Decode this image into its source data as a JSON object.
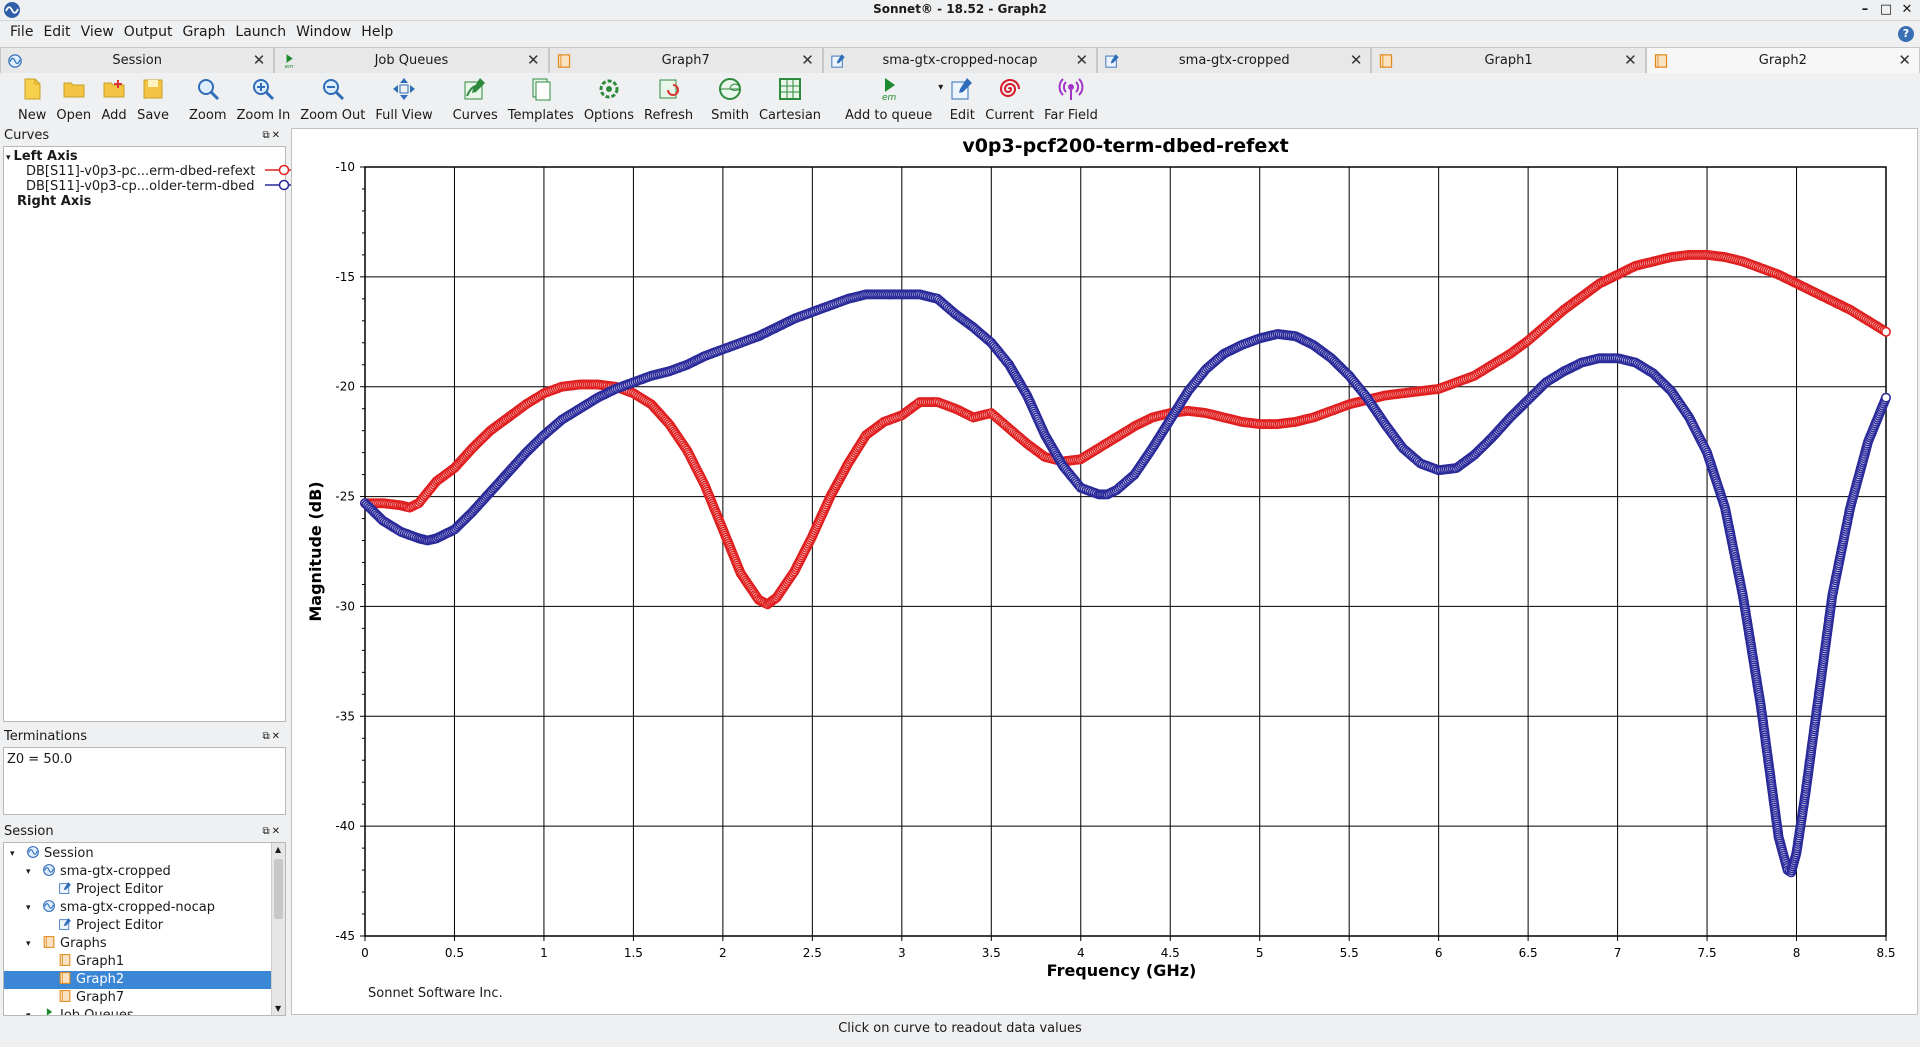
{
  "window": {
    "title": "Sonnet® - 18.52 - Graph2",
    "min_label": "–",
    "max_label": "□",
    "close_label": "✕"
  },
  "menu": [
    "File",
    "Edit",
    "View",
    "Output",
    "Graph",
    "Launch",
    "Window",
    "Help"
  ],
  "tabs": [
    {
      "label": "Session",
      "icon": "sonnet-session-icon",
      "active": false
    },
    {
      "label": "Job Queues",
      "icon": "em-queue-icon",
      "active": false
    },
    {
      "label": "Graph7",
      "icon": "graph-doc-icon",
      "active": false
    },
    {
      "label": "sma-gtx-cropped-nocap",
      "icon": "project-editor-icon",
      "active": false
    },
    {
      "label": "sma-gtx-cropped",
      "icon": "project-editor-icon",
      "active": false
    },
    {
      "label": "Graph1",
      "icon": "graph-doc-icon",
      "active": false
    },
    {
      "label": "Graph2",
      "icon": "graph-doc-icon",
      "active": true
    }
  ],
  "toolbar": [
    {
      "label": "New",
      "icon": "new-file-icon"
    },
    {
      "label": "Open",
      "icon": "open-folder-icon"
    },
    {
      "label": "Add",
      "icon": "add-folder-icon"
    },
    {
      "label": "Save",
      "icon": "save-icon"
    },
    {
      "label": "Zoom",
      "icon": "zoom-icon"
    },
    {
      "label": "Zoom In",
      "icon": "zoom-in-icon"
    },
    {
      "label": "Zoom Out",
      "icon": "zoom-out-icon"
    },
    {
      "label": "Full View",
      "icon": "full-view-icon"
    },
    {
      "label": "Curves",
      "icon": "curves-icon"
    },
    {
      "label": "Templates",
      "icon": "templates-icon"
    },
    {
      "label": "Options",
      "icon": "options-icon"
    },
    {
      "label": "Refresh",
      "icon": "refresh-icon"
    },
    {
      "label": "Smith",
      "icon": "smith-chart-icon"
    },
    {
      "label": "Cartesian",
      "icon": "cartesian-grid-icon"
    },
    {
      "label": "Add to queue",
      "icon": "em-run-icon"
    },
    {
      "label": "Edit",
      "icon": "edit-icon"
    },
    {
      "label": "Current",
      "icon": "current-spiral-icon"
    },
    {
      "label": "Far Field",
      "icon": "far-field-icon"
    }
  ],
  "curves_panel": {
    "title": "Curves",
    "left_axis": "Left Axis",
    "right_axis": "Right Axis",
    "curves": [
      {
        "label": "DB[S11]-v0p3-pc...erm-dbed-refext",
        "color": "#e02020"
      },
      {
        "label": "DB[S11]-v0p3-cp...older-term-dbed",
        "color": "#2a2a9a"
      }
    ]
  },
  "terminations_panel": {
    "title": "Terminations",
    "value": "Z0 = 50.0"
  },
  "session_panel": {
    "title": "Session",
    "tree": [
      {
        "label": "Session",
        "indent": 0,
        "twist": "▾",
        "icon": "sonnet-session-icon",
        "selected": false
      },
      {
        "label": "sma-gtx-cropped",
        "indent": 1,
        "twist": "▾",
        "icon": "sonnet-project-icon",
        "selected": false
      },
      {
        "label": "Project Editor",
        "indent": 2,
        "twist": "",
        "icon": "project-editor-icon",
        "selected": false
      },
      {
        "label": "sma-gtx-cropped-nocap",
        "indent": 1,
        "twist": "▾",
        "icon": "sonnet-project-icon",
        "selected": false
      },
      {
        "label": "Project Editor",
        "indent": 2,
        "twist": "",
        "icon": "project-editor-icon",
        "selected": false
      },
      {
        "label": "Graphs",
        "indent": 1,
        "twist": "▾",
        "icon": "graph-doc-icon",
        "selected": false
      },
      {
        "label": "Graph1",
        "indent": 2,
        "twist": "",
        "icon": "graph-doc-icon",
        "selected": false
      },
      {
        "label": "Graph2",
        "indent": 2,
        "twist": "",
        "icon": "graph-doc-icon",
        "selected": true
      },
      {
        "label": "Graph7",
        "indent": 2,
        "twist": "",
        "icon": "graph-doc-icon",
        "selected": false
      },
      {
        "label": "Job Queues",
        "indent": 1,
        "twist": "▾",
        "icon": "em-queue-icon",
        "selected": false
      }
    ]
  },
  "footer_text": "Sonnet Software Inc.",
  "status_text": "Click on curve to readout data values",
  "chart_data": {
    "type": "line",
    "title": "v0p3-pcf200-term-dbed-refext",
    "xlabel": "Frequency (GHz)",
    "ylabel": "Magnitude (dB)",
    "xlim": [
      0,
      8.5
    ],
    "ylim": [
      -45,
      -10
    ],
    "xticks": [
      0,
      0.5,
      1,
      1.5,
      2,
      2.5,
      3,
      3.5,
      4,
      4.5,
      5,
      5.5,
      6,
      6.5,
      7,
      7.5,
      8,
      8.5
    ],
    "xtick_labels": [
      "0",
      "0.5",
      "1",
      "1.5",
      "2",
      "2.5",
      "3",
      "3.5",
      "4",
      "4.5",
      "5",
      "5.5",
      "6",
      "6.5",
      "7",
      "7.5",
      "8",
      "8.5"
    ],
    "yticks": [
      -10,
      -15,
      -20,
      -25,
      -30,
      -35,
      -40,
      -45
    ],
    "ytick_labels": [
      "-10",
      "-15",
      "-20",
      "-25",
      "-30",
      "-35",
      "-40",
      "-45"
    ],
    "grid": true,
    "series": [
      {
        "name": "DB[S11]-v0p3-pc...erm-dbed-refext",
        "color": "#e02020",
        "x": [
          0,
          0.1,
          0.2,
          0.25,
          0.3,
          0.4,
          0.5,
          0.6,
          0.7,
          0.8,
          0.9,
          1.0,
          1.1,
          1.2,
          1.3,
          1.4,
          1.5,
          1.6,
          1.7,
          1.8,
          1.9,
          2.0,
          2.1,
          2.2,
          2.25,
          2.3,
          2.4,
          2.5,
          2.6,
          2.7,
          2.8,
          2.9,
          3.0,
          3.1,
          3.2,
          3.3,
          3.4,
          3.5,
          3.6,
          3.7,
          3.8,
          3.9,
          4.0,
          4.1,
          4.2,
          4.3,
          4.4,
          4.5,
          4.6,
          4.7,
          4.8,
          4.9,
          5.0,
          5.1,
          5.2,
          5.3,
          5.4,
          5.5,
          5.6,
          5.7,
          5.8,
          5.9,
          6.0,
          6.1,
          6.2,
          6.3,
          6.4,
          6.5,
          6.6,
          6.7,
          6.8,
          6.9,
          7.0,
          7.1,
          7.2,
          7.3,
          7.4,
          7.5,
          7.6,
          7.7,
          7.8,
          7.9,
          8.0,
          8.1,
          8.2,
          8.3,
          8.4,
          8.5
        ],
        "y": [
          -25.3,
          -25.3,
          -25.4,
          -25.5,
          -25.3,
          -24.3,
          -23.7,
          -22.8,
          -22.0,
          -21.4,
          -20.8,
          -20.3,
          -20.0,
          -19.9,
          -19.9,
          -20.0,
          -20.3,
          -20.8,
          -21.7,
          -22.9,
          -24.5,
          -26.5,
          -28.5,
          -29.7,
          -29.9,
          -29.6,
          -28.4,
          -26.8,
          -25.0,
          -23.5,
          -22.2,
          -21.6,
          -21.3,
          -20.7,
          -20.7,
          -21.0,
          -21.4,
          -21.2,
          -21.9,
          -22.6,
          -23.2,
          -23.4,
          -23.3,
          -22.8,
          -22.3,
          -21.8,
          -21.4,
          -21.2,
          -21.1,
          -21.2,
          -21.4,
          -21.6,
          -21.7,
          -21.7,
          -21.6,
          -21.4,
          -21.1,
          -20.8,
          -20.6,
          -20.4,
          -20.3,
          -20.2,
          -20.1,
          -19.8,
          -19.5,
          -19.0,
          -18.5,
          -17.9,
          -17.2,
          -16.5,
          -15.9,
          -15.3,
          -14.9,
          -14.5,
          -14.3,
          -14.1,
          -14.0,
          -14.0,
          -14.1,
          -14.3,
          -14.6,
          -14.9,
          -15.3,
          -15.7,
          -16.1,
          -16.5,
          -17.0,
          -17.5
        ]
      },
      {
        "name": "DB[S11]-v0p3-cp...older-term-dbed",
        "color": "#2a2a9a",
        "x": [
          0,
          0.1,
          0.2,
          0.3,
          0.35,
          0.4,
          0.5,
          0.6,
          0.7,
          0.8,
          0.9,
          1.0,
          1.1,
          1.2,
          1.3,
          1.4,
          1.5,
          1.6,
          1.7,
          1.8,
          1.9,
          2.0,
          2.1,
          2.2,
          2.3,
          2.4,
          2.5,
          2.6,
          2.7,
          2.8,
          2.9,
          3.0,
          3.1,
          3.2,
          3.3,
          3.4,
          3.5,
          3.6,
          3.7,
          3.8,
          3.9,
          4.0,
          4.1,
          4.15,
          4.2,
          4.3,
          4.4,
          4.5,
          4.6,
          4.7,
          4.8,
          4.9,
          5.0,
          5.1,
          5.2,
          5.3,
          5.4,
          5.5,
          5.6,
          5.7,
          5.8,
          5.9,
          6.0,
          6.1,
          6.2,
          6.3,
          6.4,
          6.5,
          6.6,
          6.7,
          6.8,
          6.9,
          7.0,
          7.1,
          7.2,
          7.3,
          7.4,
          7.5,
          7.6,
          7.7,
          7.75,
          7.8,
          7.85,
          7.9,
          7.95,
          7.97,
          8.0,
          8.05,
          8.1,
          8.15,
          8.2,
          8.3,
          8.4,
          8.5
        ],
        "y": [
          -25.3,
          -26.1,
          -26.6,
          -26.9,
          -27.0,
          -26.9,
          -26.5,
          -25.7,
          -24.8,
          -23.9,
          -23.0,
          -22.2,
          -21.5,
          -21.0,
          -20.5,
          -20.1,
          -19.8,
          -19.5,
          -19.3,
          -19.0,
          -18.6,
          -18.3,
          -18.0,
          -17.7,
          -17.3,
          -16.9,
          -16.6,
          -16.3,
          -16.0,
          -15.8,
          -15.8,
          -15.8,
          -15.8,
          -16.0,
          -16.7,
          -17.3,
          -18.0,
          -19.0,
          -20.4,
          -22.2,
          -23.6,
          -24.6,
          -24.9,
          -24.9,
          -24.7,
          -24.0,
          -22.8,
          -21.5,
          -20.2,
          -19.2,
          -18.5,
          -18.1,
          -17.8,
          -17.6,
          -17.7,
          -18.1,
          -18.7,
          -19.5,
          -20.5,
          -21.7,
          -22.8,
          -23.5,
          -23.8,
          -23.7,
          -23.1,
          -22.3,
          -21.4,
          -20.6,
          -19.8,
          -19.3,
          -18.9,
          -18.7,
          -18.7,
          -18.9,
          -19.4,
          -20.2,
          -21.4,
          -23.0,
          -25.5,
          -29.5,
          -32.0,
          -34.5,
          -37.5,
          -40.5,
          -42.0,
          -42.1,
          -41.2,
          -38.5,
          -35.5,
          -32.5,
          -29.5,
          -25.5,
          -22.5,
          -20.5
        ]
      }
    ]
  }
}
